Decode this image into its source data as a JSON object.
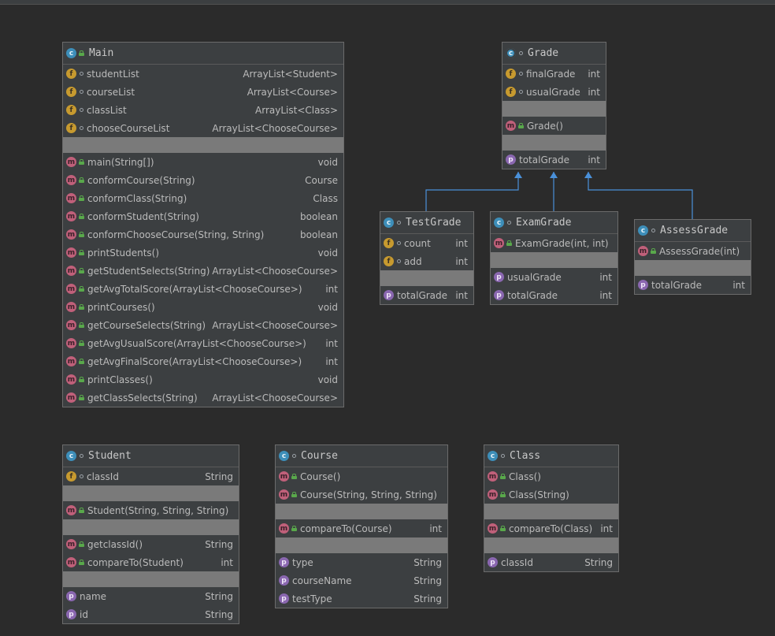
{
  "diagram": {
    "classes": {
      "main": {
        "name": "Main",
        "fields": [
          {
            "name": "studentList",
            "type": "ArrayList<Student>"
          },
          {
            "name": "courseList",
            "type": "ArrayList<Course>"
          },
          {
            "name": "classList",
            "type": "ArrayList<Class>"
          },
          {
            "name": "chooseCourseList",
            "type": "ArrayList<ChooseCourse>"
          }
        ],
        "methods": [
          {
            "name": "main(String[])",
            "type": "void"
          },
          {
            "name": "conformCourse(String)",
            "type": "Course"
          },
          {
            "name": "conformClass(String)",
            "type": "Class"
          },
          {
            "name": "conformStudent(String)",
            "type": "boolean"
          },
          {
            "name": "conformChooseCourse(String, String)",
            "type": "boolean"
          },
          {
            "name": "printStudents()",
            "type": "void"
          },
          {
            "name": "getStudentSelects(String)",
            "type": "ArrayList<ChooseCourse>"
          },
          {
            "name": "getAvgTotalScore(ArrayList<ChooseCourse>)",
            "type": "int"
          },
          {
            "name": "printCourses()",
            "type": "void"
          },
          {
            "name": "getCourseSelects(String)",
            "type": "ArrayList<ChooseCourse>"
          },
          {
            "name": "getAvgUsualScore(ArrayList<ChooseCourse>)",
            "type": "int"
          },
          {
            "name": "getAvgFinalScore(ArrayList<ChooseCourse>)",
            "type": "int"
          },
          {
            "name": "printClasses()",
            "type": "void"
          },
          {
            "name": "getClassSelects(String)",
            "type": "ArrayList<ChooseCourse>"
          }
        ]
      },
      "grade": {
        "name": "Grade",
        "fields": [
          {
            "name": "finalGrade",
            "type": "int"
          },
          {
            "name": "usualGrade",
            "type": "int"
          }
        ],
        "methods": [
          {
            "name": "Grade()",
            "type": ""
          }
        ],
        "properties": [
          {
            "name": "totalGrade",
            "type": "int"
          }
        ]
      },
      "testGrade": {
        "name": "TestGrade",
        "fields": [
          {
            "name": "count",
            "type": "int"
          },
          {
            "name": "add",
            "type": "int"
          }
        ],
        "properties": [
          {
            "name": "totalGrade",
            "type": "int"
          }
        ]
      },
      "examGrade": {
        "name": "ExamGrade",
        "methods": [
          {
            "name": "ExamGrade(int, int)",
            "type": ""
          }
        ],
        "properties": [
          {
            "name": "usualGrade",
            "type": "int"
          },
          {
            "name": "totalGrade",
            "type": "int"
          }
        ]
      },
      "assessGrade": {
        "name": "AssessGrade",
        "methods": [
          {
            "name": "AssessGrade(int)",
            "type": ""
          }
        ],
        "properties": [
          {
            "name": "totalGrade",
            "type": "int"
          }
        ]
      },
      "student": {
        "name": "Student",
        "fields": [
          {
            "name": "classId",
            "type": "String"
          }
        ],
        "constructors": [
          {
            "name": "Student(String, String, String)",
            "type": ""
          }
        ],
        "methods": [
          {
            "name": "getclassId()",
            "type": "String"
          },
          {
            "name": "compareTo(Student)",
            "type": "int"
          }
        ],
        "properties": [
          {
            "name": "name",
            "type": "String"
          },
          {
            "name": "id",
            "type": "String"
          }
        ]
      },
      "course": {
        "name": "Course",
        "constructors": [
          {
            "name": "Course()",
            "type": ""
          },
          {
            "name": "Course(String, String, String)",
            "type": ""
          }
        ],
        "methods": [
          {
            "name": "compareTo(Course)",
            "type": "int"
          }
        ],
        "properties": [
          {
            "name": "type",
            "type": "String"
          },
          {
            "name": "courseName",
            "type": "String"
          },
          {
            "name": "testType",
            "type": "String"
          }
        ]
      },
      "klass": {
        "name": "Class",
        "constructors": [
          {
            "name": "Class()",
            "type": ""
          },
          {
            "name": "Class(String)",
            "type": ""
          }
        ],
        "methods": [
          {
            "name": "compareTo(Class)",
            "type": "int"
          }
        ],
        "properties": [
          {
            "name": "classId",
            "type": "String"
          }
        ]
      }
    },
    "icons": {
      "class": "c",
      "field": "f",
      "method": "m",
      "property": "p"
    },
    "colors": {
      "background": "#2b2b2b",
      "box": "#3c3f41",
      "separator": "#7a7a7a",
      "inheritance_arrow": "#4a90d9",
      "class_icon": "#3d8eb9",
      "field_icon": "#c79a2f",
      "method_icon": "#c0607a",
      "property_icon": "#8a67b0",
      "public_lock": "#59a84b"
    }
  }
}
